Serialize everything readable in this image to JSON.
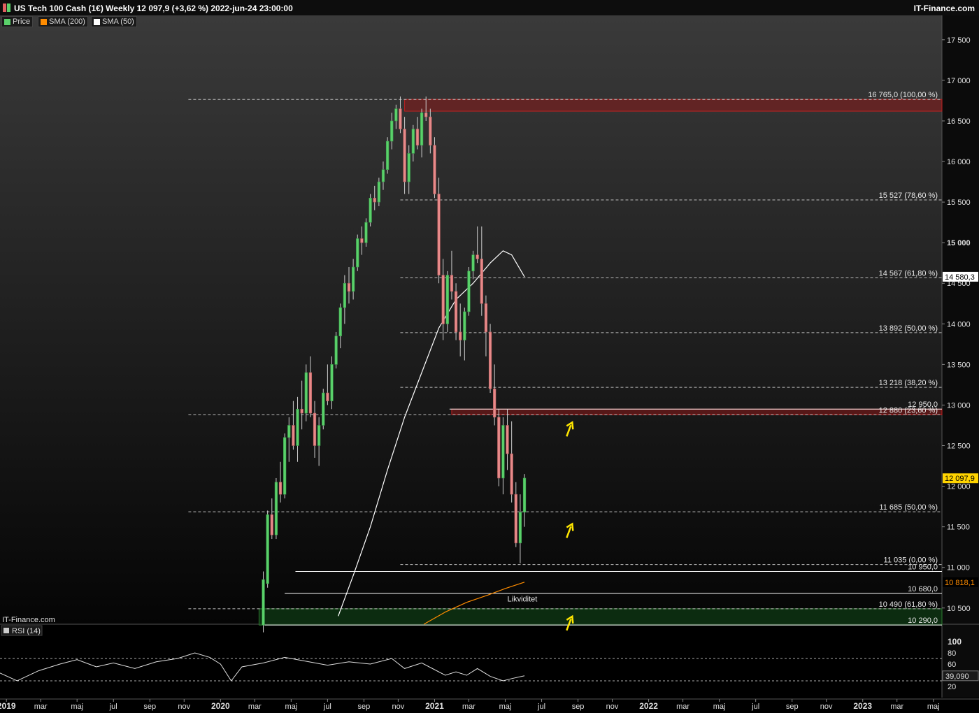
{
  "header": {
    "title": "US Tech 100 Cash (1€) Weekly 12 097,9 (+3,62 %) 2022-jun-24 23:00:00",
    "brand": "IT-Finance.com",
    "watermark": "IT-Finance.com"
  },
  "legend": [
    {
      "label": "Price",
      "color": "#5ad16a"
    },
    {
      "label": "SMA (200)",
      "color": "#ff8c00"
    },
    {
      "label": "SMA (50)",
      "color": "#ffffff"
    }
  ],
  "rsi_panel": {
    "label": "RSI (14)",
    "ticks": [
      "100",
      "80",
      "60",
      "40",
      "20"
    ],
    "current": "39,090"
  },
  "price_axis": {
    "ticks": [
      "17 500",
      "17 000",
      "16 500",
      "16 000",
      "15 500",
      "15 000",
      "14 500",
      "14 000",
      "13 500",
      "13 000",
      "12 500",
      "12 000",
      "11 500",
      "11 000",
      "10 500"
    ],
    "last_price": "12 097,9",
    "sma50_value": "14 580,3",
    "sma200_value": "10 818,1"
  },
  "time_axis": {
    "labels": [
      {
        "t": "2019",
        "x": 2019.0,
        "bold": true
      },
      {
        "t": "mar",
        "x": 2019.16
      },
      {
        "t": "maj",
        "x": 2019.33
      },
      {
        "t": "jul",
        "x": 2019.5
      },
      {
        "t": "sep",
        "x": 2019.67
      },
      {
        "t": "nov",
        "x": 2019.83
      },
      {
        "t": "2020",
        "x": 2020.0,
        "bold": true
      },
      {
        "t": "mar",
        "x": 2020.16
      },
      {
        "t": "maj",
        "x": 2020.33
      },
      {
        "t": "jul",
        "x": 2020.5
      },
      {
        "t": "sep",
        "x": 2020.67
      },
      {
        "t": "nov",
        "x": 2020.83
      },
      {
        "t": "2021",
        "x": 2021.0,
        "bold": true
      },
      {
        "t": "mar",
        "x": 2021.16
      },
      {
        "t": "maj",
        "x": 2021.33
      },
      {
        "t": "jul",
        "x": 2021.5
      },
      {
        "t": "sep",
        "x": 2021.67
      },
      {
        "t": "nov",
        "x": 2021.83
      },
      {
        "t": "2022",
        "x": 2022.0,
        "bold": true
      },
      {
        "t": "mar",
        "x": 2022.16
      },
      {
        "t": "maj",
        "x": 2022.33
      },
      {
        "t": "jul",
        "x": 2022.5
      },
      {
        "t": "sep",
        "x": 2022.67
      },
      {
        "t": "nov",
        "x": 2022.83
      },
      {
        "t": "2023",
        "x": 2023.0,
        "bold": true
      },
      {
        "t": "mar",
        "x": 2023.16
      },
      {
        "t": "maj",
        "x": 2023.33
      }
    ]
  },
  "chart_data": {
    "type": "candlestick",
    "instrument": "US Tech 100 Cash (1€)",
    "interval": "Weekly",
    "last_close": 12097.9,
    "change_pct": 3.62,
    "ylim": [
      10300,
      17800
    ],
    "xlim": [
      2018.97,
      2023.37
    ],
    "rsi_ylim": [
      0,
      110
    ],
    "candles": [
      [
        2020.2,
        10290,
        10950,
        10200,
        10850
      ],
      [
        2020.22,
        10800,
        11700,
        10750,
        11650
      ],
      [
        2020.24,
        11650,
        11850,
        11350,
        11400
      ],
      [
        2020.26,
        11400,
        12100,
        11350,
        12050
      ],
      [
        2020.28,
        12050,
        12300,
        11800,
        11900
      ],
      [
        2020.3,
        11900,
        12650,
        11850,
        12600
      ],
      [
        2020.32,
        12600,
        12850,
        12300,
        12750
      ],
      [
        2020.34,
        12750,
        13050,
        12450,
        12500
      ],
      [
        2020.36,
        12500,
        13100,
        12300,
        12950
      ],
      [
        2020.38,
        12950,
        13300,
        12700,
        12900
      ],
      [
        2020.4,
        12900,
        13500,
        12800,
        13400
      ],
      [
        2020.42,
        13400,
        13600,
        12850,
        12900
      ],
      [
        2020.44,
        12900,
        13050,
        12350,
        12500
      ],
      [
        2020.46,
        12500,
        12850,
        12250,
        12750
      ],
      [
        2020.48,
        12750,
        13200,
        12700,
        13150
      ],
      [
        2020.5,
        13150,
        13500,
        13000,
        13050
      ],
      [
        2020.52,
        13050,
        13600,
        12950,
        13500
      ],
      [
        2020.54,
        13500,
        13900,
        13450,
        13850
      ],
      [
        2020.56,
        13850,
        14250,
        13700,
        14200
      ],
      [
        2020.58,
        14200,
        14600,
        14000,
        14500
      ],
      [
        2020.6,
        14500,
        14700,
        14250,
        14400
      ],
      [
        2020.62,
        14400,
        14800,
        14300,
        14700
      ],
      [
        2020.64,
        14700,
        15100,
        14650,
        15050
      ],
      [
        2020.66,
        15050,
        15200,
        14850,
        15000
      ],
      [
        2020.68,
        15000,
        15300,
        14950,
        15250
      ],
      [
        2020.7,
        15250,
        15600,
        15200,
        15550
      ],
      [
        2020.72,
        15550,
        15700,
        15400,
        15500
      ],
      [
        2020.74,
        15500,
        15800,
        15450,
        15750
      ],
      [
        2020.76,
        15750,
        16000,
        15650,
        15900
      ],
      [
        2020.78,
        15900,
        16300,
        15850,
        16250
      ],
      [
        2020.8,
        16250,
        16600,
        16150,
        16500
      ],
      [
        2020.82,
        16500,
        16700,
        16400,
        16650
      ],
      [
        2020.84,
        16650,
        16800,
        16350,
        16400
      ],
      [
        2020.86,
        16400,
        16550,
        15600,
        15750
      ],
      [
        2020.88,
        15750,
        16200,
        15600,
        16100
      ],
      [
        2020.9,
        16100,
        16450,
        16000,
        16400
      ],
      [
        2020.92,
        16400,
        16550,
        16150,
        16200
      ],
      [
        2020.94,
        16200,
        16650,
        16050,
        16600
      ],
      [
        2020.96,
        16600,
        16800,
        16500,
        16550
      ],
      [
        2020.98,
        16550,
        16650,
        16100,
        16200
      ],
      [
        2021.0,
        16200,
        16300,
        15550,
        15600
      ],
      [
        2021.02,
        15600,
        15800,
        14500,
        14600
      ],
      [
        2021.04,
        14600,
        14800,
        13800,
        14000
      ],
      [
        2021.06,
        14000,
        14650,
        13900,
        14600
      ],
      [
        2021.08,
        14600,
        14900,
        14300,
        14400
      ],
      [
        2021.1,
        14400,
        14500,
        13800,
        13900
      ],
      [
        2021.12,
        13900,
        14250,
        13600,
        13800
      ],
      [
        2021.14,
        13800,
        14200,
        13550,
        14150
      ],
      [
        2021.16,
        14150,
        14700,
        14100,
        14650
      ],
      [
        2021.18,
        14650,
        14900,
        14550,
        14850
      ],
      [
        2021.2,
        14850,
        15200,
        14750,
        14800
      ],
      [
        2021.22,
        14800,
        15200,
        14100,
        14250
      ],
      [
        2021.24,
        14250,
        14350,
        13600,
        13900
      ],
      [
        2021.26,
        13900,
        14000,
        13150,
        13200
      ],
      [
        2021.28,
        13200,
        13500,
        12750,
        12850
      ],
      [
        2021.3,
        12850,
        12950,
        12000,
        12100
      ],
      [
        2021.32,
        12100,
        12850,
        11900,
        12750
      ],
      [
        2021.34,
        12750,
        12950,
        12200,
        12400
      ],
      [
        2021.36,
        12400,
        12800,
        11800,
        11900
      ],
      [
        2021.38,
        11900,
        12050,
        11250,
        11300
      ],
      [
        2021.4,
        11300,
        11900,
        11050,
        11680
      ],
      [
        2021.42,
        11680,
        12150,
        11500,
        12100
      ]
    ],
    "sma50": [
      [
        2020.55,
        10400
      ],
      [
        2020.62,
        10900
      ],
      [
        2020.7,
        11500
      ],
      [
        2020.78,
        12200
      ],
      [
        2020.86,
        12850
      ],
      [
        2020.94,
        13400
      ],
      [
        2021.02,
        13950
      ],
      [
        2021.1,
        14300
      ],
      [
        2021.18,
        14500
      ],
      [
        2021.26,
        14750
      ],
      [
        2021.32,
        14900
      ],
      [
        2021.36,
        14850
      ],
      [
        2021.42,
        14580
      ]
    ],
    "sma200": [
      [
        2020.95,
        10300
      ],
      [
        2021.05,
        10450
      ],
      [
        2021.15,
        10570
      ],
      [
        2021.25,
        10660
      ],
      [
        2021.33,
        10740
      ],
      [
        2021.42,
        10818
      ]
    ],
    "levels": [
      {
        "label": "16 765,0 (100,00 %)",
        "value": 16765,
        "style": "dashed",
        "from": 2019.85
      },
      {
        "label": "15 527 (78,60 %)",
        "value": 15527,
        "style": "dashed",
        "from": 2020.84
      },
      {
        "label": "14 567 (61,80 %)",
        "value": 14567,
        "style": "dashed",
        "from": 2020.84
      },
      {
        "label": "13 892 (50,00 %)",
        "value": 13892,
        "style": "dashed",
        "from": 2020.84
      },
      {
        "label": "13 218 (38,20 %)",
        "value": 13218,
        "style": "dashed",
        "from": 2020.84
      },
      {
        "label": "12 950,0",
        "value": 12950,
        "style": "solid",
        "from": 2021.07
      },
      {
        "label": "12 880 (23,60 %)",
        "value": 12880,
        "style": "dashed",
        "from": 2019.85
      },
      {
        "label": "11 685 (50,00 %)",
        "value": 11685,
        "style": "dashed",
        "from": 2019.85
      },
      {
        "label": "11 035 (0,00 %)",
        "value": 11035,
        "style": "dashed",
        "from": 2020.84
      },
      {
        "label": "10 950,0",
        "value": 10950,
        "style": "solid",
        "from": 2020.35
      },
      {
        "label": "10 680,0",
        "value": 10680,
        "style": "solid",
        "from": 2020.3
      },
      {
        "label": "10 490 (61,80 %)",
        "value": 10490,
        "style": "dashed",
        "from": 2019.85
      },
      {
        "label": "10 290,0",
        "value": 10290,
        "style": "solid",
        "from": 2020.2
      }
    ],
    "zones": [
      {
        "name": "resistance-zone-top",
        "from": 2020.86,
        "to": 2023.37,
        "low": 16620,
        "high": 16765,
        "color": "#8b1a1a"
      },
      {
        "name": "resistance-zone-mid",
        "from": 2021.08,
        "to": 2023.37,
        "low": 12880,
        "high": 12950,
        "color": "#8b1a1a"
      },
      {
        "name": "support-zone",
        "from": 2020.18,
        "to": 2023.37,
        "low": 10290,
        "high": 10490,
        "color": "#0f3a14"
      }
    ],
    "annotations": [
      {
        "text": "Likviditet",
        "x": 2021.34,
        "y": 10580
      }
    ],
    "arrows": [
      {
        "x": 2021.63,
        "y": 12700
      },
      {
        "x": 2021.63,
        "y": 11450
      },
      {
        "x": 2021.63,
        "y": 10310
      }
    ],
    "rsi": [
      [
        2018.97,
        44
      ],
      [
        2019.05,
        30
      ],
      [
        2019.15,
        48
      ],
      [
        2019.25,
        60
      ],
      [
        2019.33,
        68
      ],
      [
        2019.42,
        55
      ],
      [
        2019.5,
        62
      ],
      [
        2019.6,
        52
      ],
      [
        2019.7,
        64
      ],
      [
        2019.8,
        70
      ],
      [
        2019.88,
        80
      ],
      [
        2019.95,
        72
      ],
      [
        2020.0,
        60
      ],
      [
        2020.05,
        30
      ],
      [
        2020.1,
        55
      ],
      [
        2020.2,
        62
      ],
      [
        2020.3,
        72
      ],
      [
        2020.4,
        65
      ],
      [
        2020.5,
        58
      ],
      [
        2020.6,
        64
      ],
      [
        2020.7,
        60
      ],
      [
        2020.8,
        70
      ],
      [
        2020.86,
        52
      ],
      [
        2020.94,
        62
      ],
      [
        2021.0,
        50
      ],
      [
        2021.05,
        40
      ],
      [
        2021.1,
        46
      ],
      [
        2021.15,
        40
      ],
      [
        2021.2,
        52
      ],
      [
        2021.26,
        38
      ],
      [
        2021.32,
        30
      ],
      [
        2021.36,
        34
      ],
      [
        2021.42,
        39
      ]
    ]
  }
}
